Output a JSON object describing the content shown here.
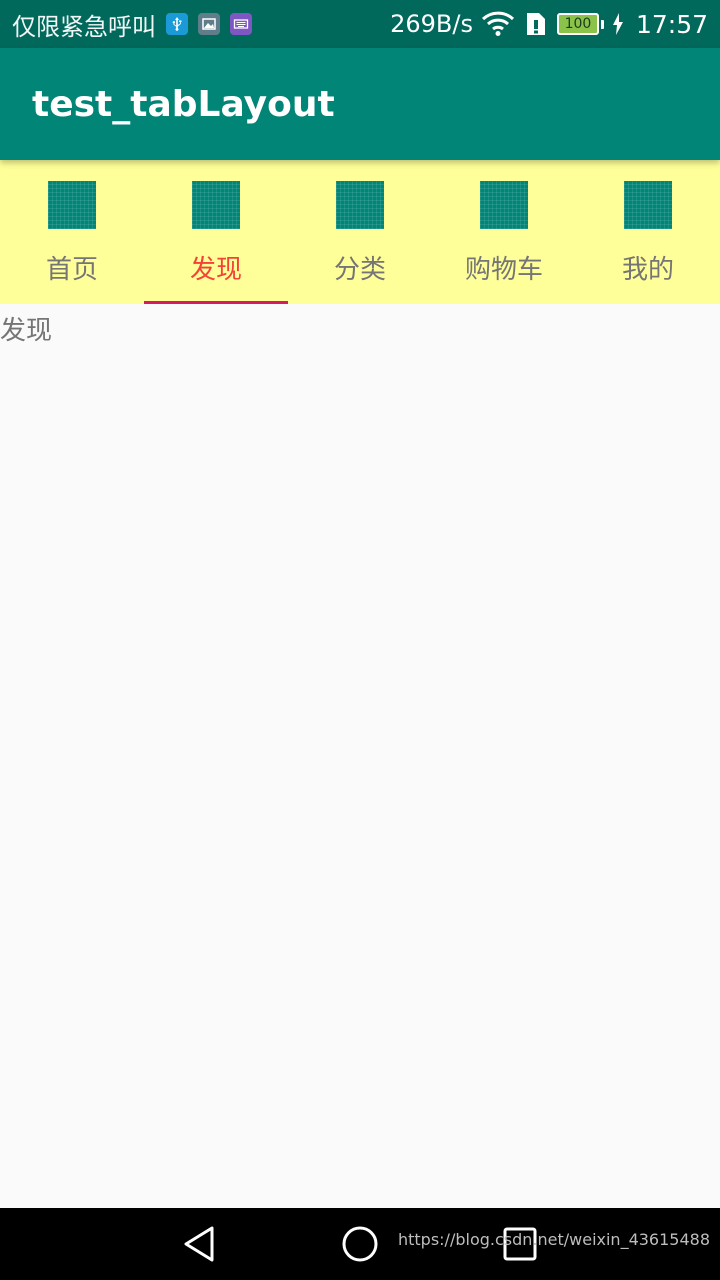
{
  "status_bar": {
    "carrier": "仅限紧急呼叫",
    "notification_icons": [
      "usb-icon",
      "gallery-icon",
      "keyboard-icon"
    ],
    "net_speed": "269B/s",
    "battery_level": "100",
    "time": "17:57"
  },
  "app_bar": {
    "title": "test_tabLayout",
    "color": "#008577"
  },
  "tabs": {
    "background": "#ffff99",
    "selected_index": 1,
    "selected_color": "#f44336",
    "indicator_color": "#d81b60",
    "items": [
      {
        "label": "首页",
        "icon": "placeholder-square-icon"
      },
      {
        "label": "发现",
        "icon": "placeholder-square-icon"
      },
      {
        "label": "分类",
        "icon": "placeholder-square-icon"
      },
      {
        "label": "购物车",
        "icon": "placeholder-square-icon"
      },
      {
        "label": "我的",
        "icon": "placeholder-square-icon"
      }
    ]
  },
  "content": {
    "text": "发现"
  },
  "nav_bar": {
    "buttons": [
      "back-icon",
      "home-icon",
      "recents-icon"
    ],
    "watermark": "https://blog.csdn.net/weixin_43615488"
  }
}
